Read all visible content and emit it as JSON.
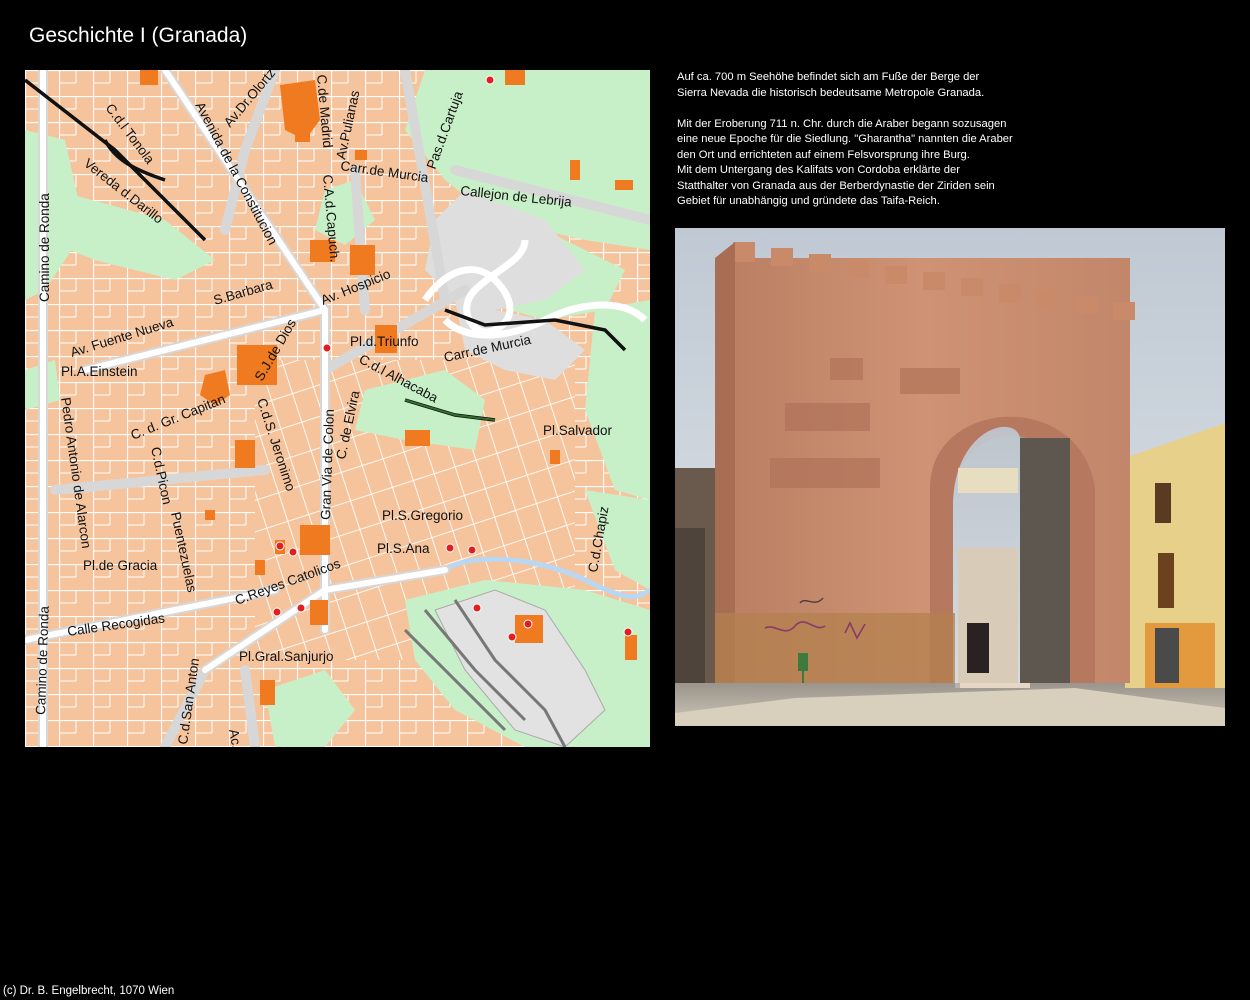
{
  "page": {
    "title": "Geschichte I (Granada)"
  },
  "map": {
    "labels": [
      {
        "text": "C.d.l Tonola"
      },
      {
        "text": "Av.Dr.Olortz"
      },
      {
        "text": "C.de Madrid"
      },
      {
        "text": "Av.Pulianas"
      },
      {
        "text": "Pas.d.Cartuja"
      },
      {
        "text": "Avenida de la Constitucion"
      },
      {
        "text": "Carr.de Murcia"
      },
      {
        "text": "Vereda d.Darillo"
      },
      {
        "text": "C.A.d.Capuch."
      },
      {
        "text": "Callejon de Lebrija"
      },
      {
        "text": "Camino de Ronda"
      },
      {
        "text": "S.Barbara"
      },
      {
        "text": "Av. Hospicio"
      },
      {
        "text": "Av. Fuente Nueva"
      },
      {
        "text": "S.J.de Dios"
      },
      {
        "text": "Pl.d.Triunfo"
      },
      {
        "text": "Carr.de Murcia"
      },
      {
        "text": "Pl.A.Einstein"
      },
      {
        "text": "C.d.l Alhacaba"
      },
      {
        "text": "C. d. Gr. Capitan"
      },
      {
        "text": "Pl.Salvador"
      },
      {
        "text": "Pedro Antonio de Alarcon"
      },
      {
        "text": "C.d.Picon"
      },
      {
        "text": "Puentezuelas"
      },
      {
        "text": "C.d.S. Jeronimo"
      },
      {
        "text": "Gran Via de Colon"
      },
      {
        "text": "C. de Elvira"
      },
      {
        "text": "Pl.S.Gregorio"
      },
      {
        "text": "C.d.Chapiz"
      },
      {
        "text": "Pl.S.Ana"
      },
      {
        "text": "Pl.de Gracia"
      },
      {
        "text": "C.Reyes Catolicos"
      },
      {
        "text": "Calle Recogidas"
      },
      {
        "text": "Camino de Ronda"
      },
      {
        "text": "Pl.Gral.Sanjurjo"
      },
      {
        "text": "C.d.San Anton"
      },
      {
        "text": "Ac.de Dario"
      }
    ]
  },
  "description": {
    "paragraph1": [
      "Auf ca. 700 m Seehöhe befindet sich am Fuße der Berge der",
      "Sierra Nevada die historisch bedeutsame Metropole Granada."
    ],
    "paragraph2": [
      "Mit der Eroberung 711 n. Chr. durch die Araber begann sozusagen",
      "eine neue Epoche für die Siedlung. \"Gharantha\" nannten die Araber",
      "den Ort und errichteten auf einem Felsvorsprung ihre Burg.",
      "Mit dem Untergang des Kalifats von Cordoba erklärte der",
      "Statthalter von Granada aus der Berberdynastie der Ziriden sein",
      "Gebiet für unabhängig und gründete das Taifa-Reich."
    ]
  },
  "footer": "(c) Dr. B. Engelbrecht, 1070 Wien",
  "colors": {
    "background": "#000000",
    "map_residential": "#f5c49c",
    "map_green": "#c8f0c8",
    "map_landmark": "#f07a20",
    "map_poi": "#e02020",
    "wall": "#c98a6a"
  },
  "icons": [
    "poi-marker-icon"
  ]
}
